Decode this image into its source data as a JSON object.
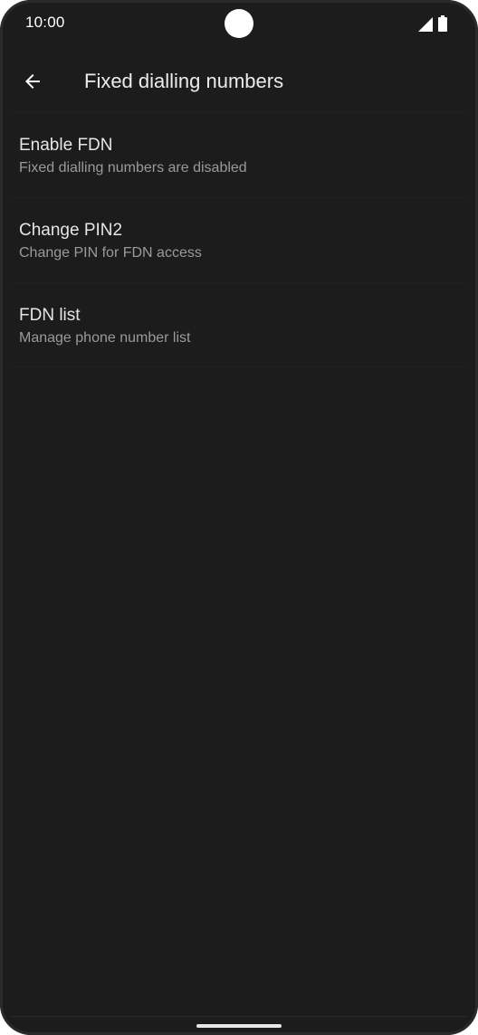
{
  "status_bar": {
    "time": "10:00",
    "icons": [
      "signal-icon",
      "battery-icon"
    ]
  },
  "app_bar": {
    "back_icon": "arrow-back-icon",
    "title": "Fixed dialling numbers"
  },
  "items": [
    {
      "title": "Enable FDN",
      "summary": "Fixed dialling numbers are disabled"
    },
    {
      "title": "Change PIN2",
      "summary": "Change PIN for FDN access"
    },
    {
      "title": "FDN list",
      "summary": "Manage phone number list"
    }
  ],
  "colors": {
    "background": "#1c1c1c",
    "title_text": "#e6e6e6",
    "summary_text": "#9a9a9a"
  }
}
